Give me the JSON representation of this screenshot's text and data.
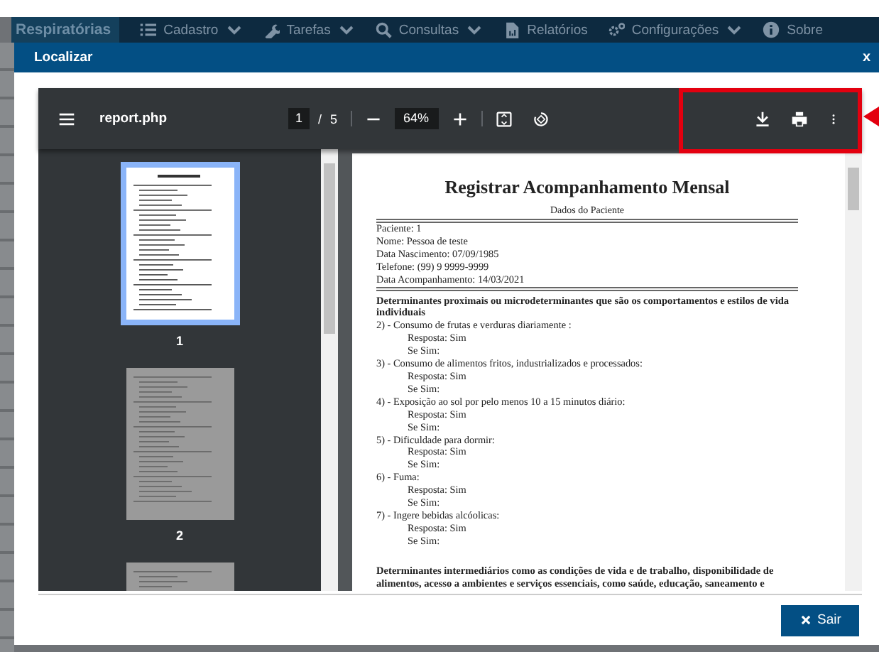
{
  "app_nav": {
    "brand": "Respiratórias",
    "items": [
      {
        "label": "Cadastro",
        "dropdown": true
      },
      {
        "label": "Tarefas",
        "dropdown": true
      },
      {
        "label": "Consultas",
        "dropdown": true
      },
      {
        "label": "Relatórios",
        "dropdown": false
      },
      {
        "label": "Configurações",
        "dropdown": true
      },
      {
        "label": "Sobre",
        "dropdown": false
      }
    ]
  },
  "dialog": {
    "title": "Localizar",
    "close": "x",
    "pdf_viewer": {
      "file_name": "report.php",
      "page": "1",
      "page_separator": "/",
      "page_count": "5",
      "zoom": "64%",
      "actions_highlighted": true,
      "thumbnails": [
        {
          "label": "1",
          "selected": true
        },
        {
          "label": "2",
          "selected": false
        },
        {
          "selected": false
        }
      ],
      "document": {
        "title": "Registrar Acompanhamento Mensal",
        "subtitle": "Dados do Paciente",
        "fields": [
          "Paciente: 1",
          "Nome: Pessoa de teste",
          "Data Nascimento: 07/09/1985",
          "Telefone: (99) 9 9999-9999",
          "Data Acompanhamento: 14/03/2021"
        ],
        "lines": [
          {
            "kind": "heading",
            "text": "Determinantes proximais ou microdeterminantes que são os comportamentos e estilos de vida individuais"
          },
          {
            "kind": "question",
            "text": "2) - Consumo de frutas e verduras diariamente :"
          },
          {
            "kind": "answer",
            "text": "Resposta: Sim"
          },
          {
            "kind": "answer",
            "text": "Se Sim:"
          },
          {
            "kind": "question",
            "text": "3) - Consumo de alimentos fritos, industrializados e processados:"
          },
          {
            "kind": "answer",
            "text": "Resposta: Sim"
          },
          {
            "kind": "answer",
            "text": "Se Sim:"
          },
          {
            "kind": "question",
            "text": "4) - Exposição ao sol por pelo menos 10 a 15 minutos diário:"
          },
          {
            "kind": "answer",
            "text": "Resposta: Sim"
          },
          {
            "kind": "answer",
            "text": "Se Sim:"
          },
          {
            "kind": "question",
            "text": "5) - Dificuldade para dormir:"
          },
          {
            "kind": "answer",
            "text": "Resposta: Sim"
          },
          {
            "kind": "answer",
            "text": "Se Sim:"
          },
          {
            "kind": "question",
            "text": "6) - Fuma:"
          },
          {
            "kind": "answer",
            "text": "Resposta: Sim"
          },
          {
            "kind": "answer",
            "text": "Se Sim:"
          },
          {
            "kind": "question",
            "text": "7) - Ingere bebidas alcóolicas:"
          },
          {
            "kind": "answer",
            "text": "Resposta: Sim"
          },
          {
            "kind": "answer",
            "text": "Se Sim:"
          },
          {
            "kind": "heading",
            "text": "Determinantes intermediários como as condições de vida e de trabalho, disponibilidade de alimentos, acesso a ambientes e serviços essenciais, como saúde, educação, saneamento e"
          }
        ]
      }
    },
    "buttons": [
      {
        "label": "Sair",
        "kind": "exit"
      }
    ]
  }
}
